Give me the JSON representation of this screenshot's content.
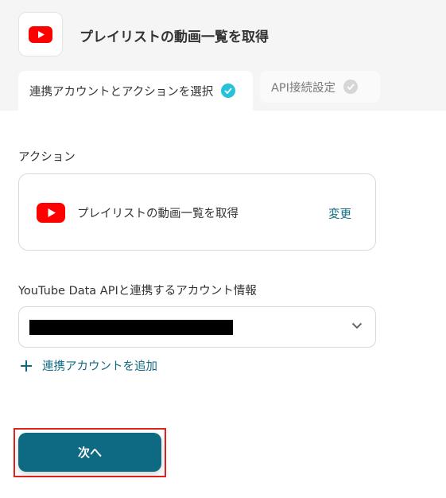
{
  "header": {
    "title": "プレイリストの動画一覧を取得",
    "app_icon": "youtube-icon"
  },
  "tabs": [
    {
      "label": "連携アカウントとアクションを選択",
      "active": true,
      "completed": true
    },
    {
      "label": "API接続設定",
      "active": false,
      "completed": false
    }
  ],
  "action_section": {
    "label": "アクション",
    "action_name": "プレイリストの動画一覧を取得",
    "change_label": "変更"
  },
  "account_section": {
    "label": "YouTube Data APIと連携するアカウント情報",
    "add_account_label": "連携アカウントを追加"
  },
  "footer": {
    "next_label": "次へ"
  },
  "colors": {
    "accent": "#0e6a82",
    "check_active": "#27c1d9",
    "youtube_red": "#ff0000",
    "highlight": "#e0211d"
  }
}
